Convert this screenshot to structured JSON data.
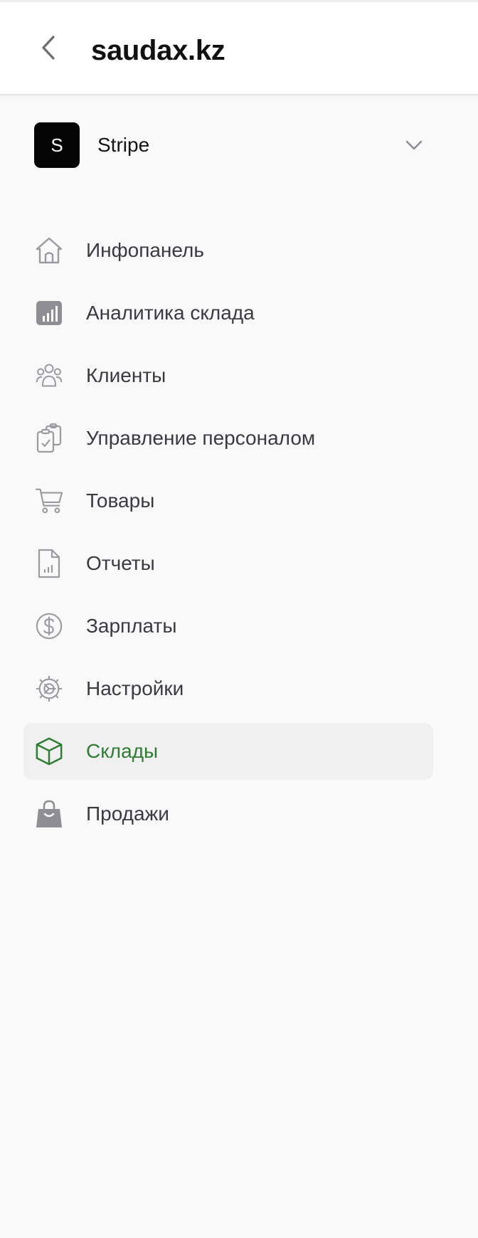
{
  "header": {
    "title": "saudax.kz",
    "back_icon": "chevron-left-icon"
  },
  "org": {
    "avatar_letter": "S",
    "name": "Stripe",
    "chevron_icon": "chevron-down-icon"
  },
  "nav": {
    "active_color": "#2e7d32",
    "items": [
      {
        "label": "Инфопанель",
        "icon": "home-icon",
        "active": false
      },
      {
        "label": "Аналитика склада",
        "icon": "bar-chart-icon",
        "active": false
      },
      {
        "label": "Клиенты",
        "icon": "users-icon",
        "active": false
      },
      {
        "label": "Управление персоналом",
        "icon": "clipboard-check-icon",
        "active": false
      },
      {
        "label": "Товары",
        "icon": "cart-icon",
        "active": false
      },
      {
        "label": "Отчеты",
        "icon": "report-icon",
        "active": false
      },
      {
        "label": "Зарплаты",
        "icon": "dollar-icon",
        "active": false
      },
      {
        "label": "Настройки",
        "icon": "gear-icon",
        "active": false
      },
      {
        "label": "Склады",
        "icon": "box-icon",
        "active": true
      },
      {
        "label": "Продажи",
        "icon": "shopping-bag-icon",
        "active": false
      }
    ]
  }
}
